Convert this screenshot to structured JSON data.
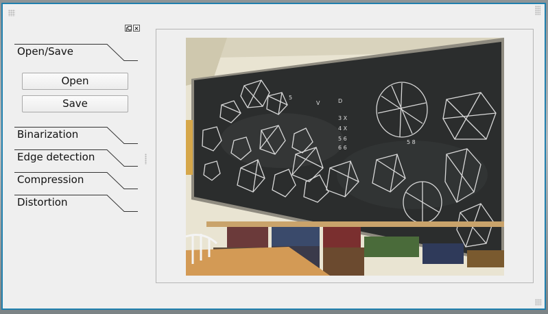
{
  "toolbox": {
    "sections": {
      "open_save": "Open/Save",
      "binarization": "Binarization",
      "edge_detection": "Edge detection",
      "compression": "Compression",
      "distortion": "Distortion"
    },
    "buttons": {
      "open": "Open",
      "save": "Save"
    },
    "dock_controls": [
      "float-icon",
      "close-icon"
    ]
  },
  "viewer": {
    "image_icon": "photo-of-blackboard-with-polyhedra-drawings"
  },
  "colors": {
    "window_border": "#1f7fae",
    "panel_background": "#efefef",
    "blackboard": "#2b2d2d"
  }
}
